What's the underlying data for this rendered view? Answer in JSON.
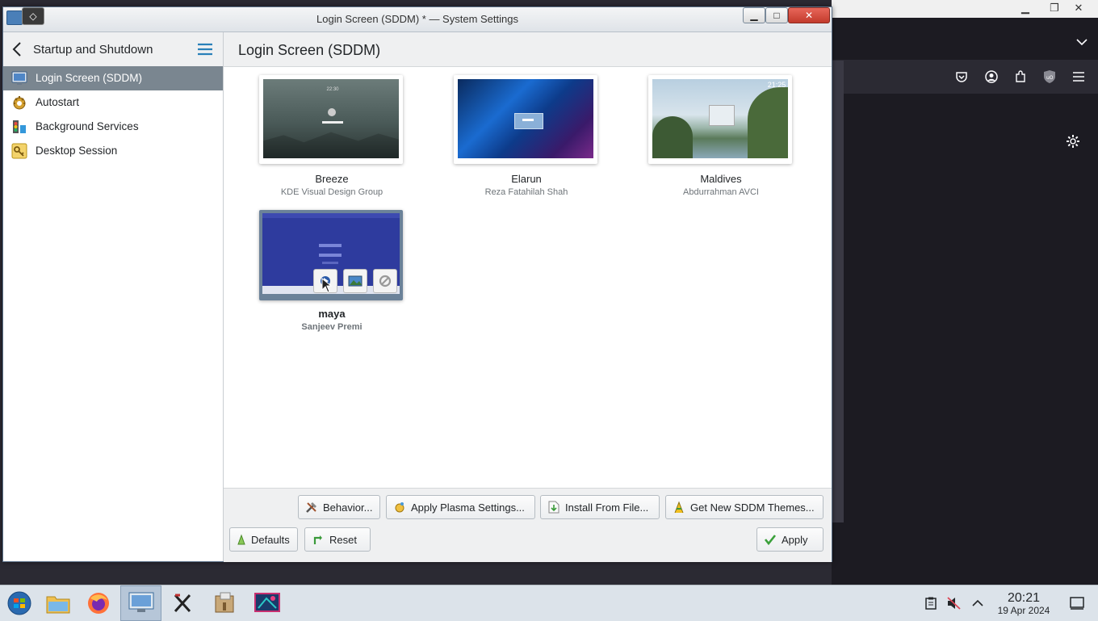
{
  "window": {
    "title": "Login Screen (SDDM) * — System Settings",
    "pin_glyph": "◇",
    "min_glyph": "▁",
    "max_glyph": "□",
    "close_glyph": "✕"
  },
  "sidebar": {
    "header": "Startup and Shutdown",
    "items": [
      {
        "label": "Login Screen (SDDM)",
        "icon": "monitor-icon",
        "selected": true
      },
      {
        "label": "Autostart",
        "icon": "gear-cog-icon",
        "selected": false
      },
      {
        "label": "Background Services",
        "icon": "services-icon",
        "selected": false
      },
      {
        "label": "Desktop Session",
        "icon": "key-icon",
        "selected": false
      }
    ]
  },
  "main": {
    "title": "Login Screen (SDDM)",
    "themes": [
      {
        "name": "Breeze",
        "author": "KDE Visual Design Group",
        "selected": false,
        "preview_time": "22:30"
      },
      {
        "name": "Elarun",
        "author": "Reza Fatahilah Shah",
        "selected": false
      },
      {
        "name": "Maldives",
        "author": "Abdurrahman AVCI",
        "selected": false,
        "preview_time": "21:25"
      },
      {
        "name": "maya",
        "author": "Sanjeev Premi",
        "selected": true
      }
    ]
  },
  "buttons": {
    "behavior": "Behavior...",
    "apply_plasma": "Apply Plasma Settings...",
    "install_file": "Install From File...",
    "get_new": "Get New SDDM Themes...",
    "defaults": "Defaults",
    "reset": "Reset",
    "apply": "Apply"
  },
  "taskbar": {
    "time": "20:21",
    "date": "19 Apr 2024",
    "apps": [
      "start-menu-icon",
      "file-manager-icon",
      "firefox-icon",
      "system-settings-icon",
      "x-app-icon",
      "archive-icon",
      "kde-app-icon"
    ]
  },
  "firefox": {
    "min_glyph": "▁",
    "max_glyph": "❐",
    "close_glyph": "✕"
  }
}
